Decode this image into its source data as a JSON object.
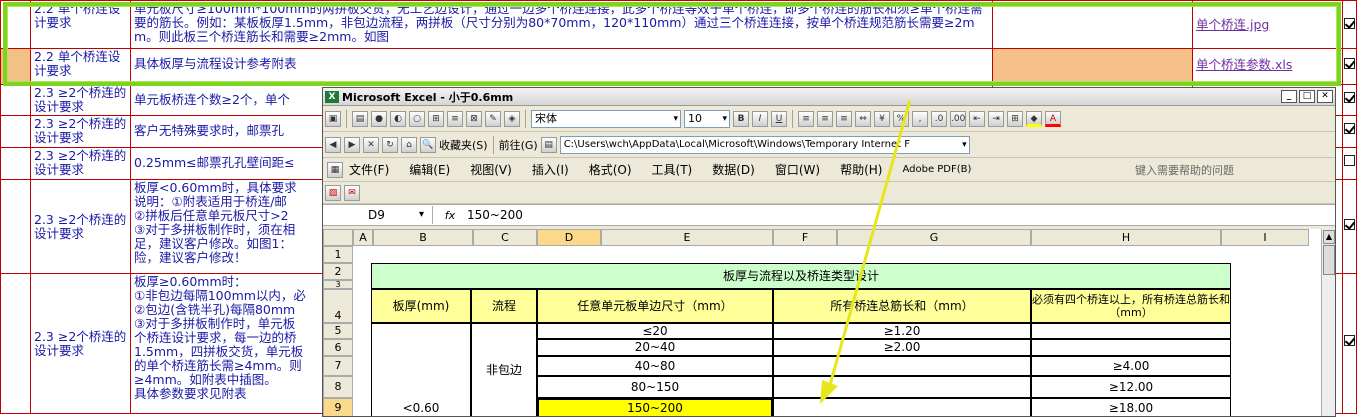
{
  "doc": {
    "rows": [
      {
        "req": "2.2 单个桥连设计要求",
        "desc": "单元板尺寸≥100mm*100mm的两拼板交货，无工艺边设计，通过一边多个桥连连接，此多个桥连等效于单个桥连，即多个桥连的筋长和须≥单个桥连需要的筋长。例如：某板板厚1.5mm，非包边流程，两拼板（尺寸分别为80*70mm，120*110mm）通过三个桥连连接，按单个桥连规范筋长需要≥2mm。则此板三个桥连筋长和需要≥2mm。如图",
        "file": "单个桥连.jpg",
        "checked": true
      },
      {
        "req": "2.2 单个桥连设计要求",
        "desc": "具体板厚与流程设计参考附表",
        "file": "单个桥连参数.xls",
        "checked": true
      },
      {
        "req": "2.3 ≥2个桥连的设计要求",
        "desc": "单元板桥连个数≥2个，单个",
        "file": "",
        "checked": true
      },
      {
        "req": "2.3 ≥2个桥连的设计要求",
        "desc": "客户无特殊要求时，邮票孔",
        "file": "",
        "checked": true
      },
      {
        "req": "2.3 ≥2个桥连的设计要求",
        "desc": "0.25mm≤邮票孔孔壁间距≤",
        "file": "",
        "checked": false
      },
      {
        "req": "2.3 ≥2个桥连的设计要求",
        "desc": "板厚<0.60mm时，具体要求\n说明：①附表适用于桥连/邮\n②拼板后任意单元板尺寸>2\n③对于多拼板制作时，须在相\n足，建议客户修改。如图1：\n险，建议客户修改！",
        "file": "",
        "checked": true
      },
      {
        "req": "2.3 ≥2个桥连的设计要求",
        "desc": "板厚≥0.60mm时：\n①非包边每隔100mm以内，必\n②包边(含铣半孔)每隔80mm\n③对于多拼板制作时，单元板\n个桥连设计要求，每一边的桥\n1.5mm，四拼板交货，单元板\n的单个桥连筋长需≥4mm。则\n≥4mm。如附表中插图。\n具体参数要求见附表",
        "file": "",
        "checked": true
      }
    ],
    "last_row_partial": "……"
  },
  "excel": {
    "title": "Microsoft Excel - 小于0.6mm",
    "font_name": "宋体",
    "font_size": "10",
    "favorites": "收藏夹(S)",
    "goto": "前往(G)",
    "path": "C:\\Users\\wch\\AppData\\Local\\Microsoft\\Windows\\Temporary Internet F",
    "menu": [
      "文件(F)",
      "编辑(E)",
      "视图(V)",
      "插入(I)",
      "格式(O)",
      "工具(T)",
      "数据(D)",
      "窗口(W)",
      "帮助(H)",
      "Adobe PDF(B)"
    ],
    "help_placeholder": "键入需要帮助的问题",
    "name_box": "D9",
    "formula": "150~200",
    "fx": "fx",
    "columns": [
      "A",
      "B",
      "C",
      "D",
      "E",
      "F",
      "G",
      "H",
      "I"
    ],
    "row_numbers": [
      "1",
      "2",
      "3",
      "4",
      "5",
      "6",
      "7",
      "8",
      "9"
    ],
    "sheet": {
      "banner": "板厚与流程以及桥连类型设计",
      "h_thickness": "板厚(mm)",
      "h_flow": "流程",
      "h_size": "任意单元板单边尺寸（mm）",
      "h_total": "所有桥连总筋长和（mm）",
      "h_four": "必须有四个桥连以上，所有桥连总筋长和（mm）",
      "flow": "非包边",
      "thickness": "<0.60",
      "sizes": [
        "≤20",
        "20~40",
        "40~80",
        "80~150",
        "150~200"
      ],
      "totals": [
        "≥1.20",
        "≥2.00",
        "",
        "",
        ""
      ],
      "fours": [
        "",
        "",
        "≥4.00",
        "≥12.00",
        "≥18.00"
      ]
    },
    "highlight_color": "#ffff00",
    "banner_color": "#ccffcc"
  }
}
